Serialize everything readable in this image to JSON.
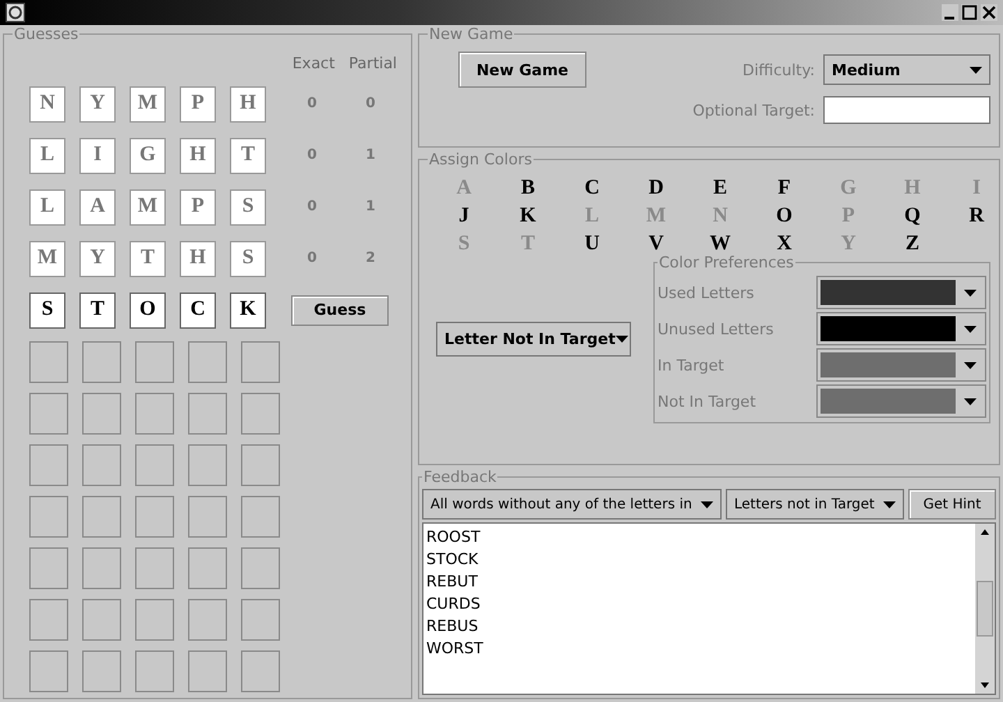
{
  "guesses": {
    "title": "Guesses",
    "columns": [
      "Exact",
      "Partial"
    ],
    "rows": [
      {
        "kind": "guess",
        "letters": [
          "N",
          "Y",
          "M",
          "P",
          "H"
        ],
        "exact": "0",
        "partial": "0"
      },
      {
        "kind": "guess",
        "letters": [
          "L",
          "I",
          "G",
          "H",
          "T"
        ],
        "exact": "0",
        "partial": "1"
      },
      {
        "kind": "guess",
        "letters": [
          "L",
          "A",
          "M",
          "P",
          "S"
        ],
        "exact": "0",
        "partial": "1"
      },
      {
        "kind": "guess",
        "letters": [
          "M",
          "Y",
          "T",
          "H",
          "S"
        ],
        "exact": "0",
        "partial": "2"
      },
      {
        "kind": "entry",
        "letters": [
          "S",
          "T",
          "O",
          "C",
          "K"
        ],
        "button": "Guess"
      },
      {
        "kind": "blank"
      },
      {
        "kind": "blank"
      },
      {
        "kind": "blank"
      },
      {
        "kind": "blank"
      },
      {
        "kind": "blank"
      },
      {
        "kind": "blank"
      },
      {
        "kind": "blank"
      }
    ]
  },
  "new_game": {
    "title": "New Game",
    "button": "New Game",
    "difficulty_label": "Difficulty:",
    "difficulty": "Medium",
    "target_label": "Optional Target:"
  },
  "assign_colors": {
    "title": "Assign Colors",
    "letters": [
      {
        "letter": "A",
        "color": "#8a8a8a"
      },
      {
        "letter": "B",
        "color": "#000000"
      },
      {
        "letter": "C",
        "color": "#000000"
      },
      {
        "letter": "D",
        "color": "#000000"
      },
      {
        "letter": "E",
        "color": "#000000"
      },
      {
        "letter": "F",
        "color": "#000000"
      },
      {
        "letter": "G",
        "color": "#8a8a8a"
      },
      {
        "letter": "H",
        "color": "#8a8a8a"
      },
      {
        "letter": "I",
        "color": "#8a8a8a"
      },
      {
        "letter": "J",
        "color": "#000000"
      },
      {
        "letter": "K",
        "color": "#000000"
      },
      {
        "letter": "L",
        "color": "#8a8a8a"
      },
      {
        "letter": "M",
        "color": "#8a8a8a"
      },
      {
        "letter": "N",
        "color": "#8a8a8a"
      },
      {
        "letter": "O",
        "color": "#000000"
      },
      {
        "letter": "P",
        "color": "#8a8a8a"
      },
      {
        "letter": "Q",
        "color": "#000000"
      },
      {
        "letter": "R",
        "color": "#000000"
      },
      {
        "letter": "S",
        "color": "#8a8a8a"
      },
      {
        "letter": "T",
        "color": "#8a8a8a"
      },
      {
        "letter": "U",
        "color": "#000000"
      },
      {
        "letter": "V",
        "color": "#000000"
      },
      {
        "letter": "W",
        "color": "#000000"
      },
      {
        "letter": "X",
        "color": "#000000"
      },
      {
        "letter": "Y",
        "color": "#8a8a8a"
      },
      {
        "letter": "Z",
        "color": "#000000"
      }
    ],
    "mode": "Letter Not In Target",
    "preferences_title": "Color Preferences",
    "preferences": [
      {
        "label": "Used Letters",
        "color": "#333333"
      },
      {
        "label": "Unused Letters",
        "color": "#000000"
      },
      {
        "label": "In Target",
        "color": "#6e6e6e"
      },
      {
        "label": "Not In Target",
        "color": "#6e6e6e"
      }
    ]
  },
  "feedback": {
    "title": "Feedback",
    "filter": "All words without any of the letters in",
    "source": "Letters not in Target",
    "button": "Get Hint",
    "words": [
      "ROOST",
      "STOCK",
      "REBUT",
      "CURDS",
      "REBUS",
      "WORST"
    ]
  }
}
